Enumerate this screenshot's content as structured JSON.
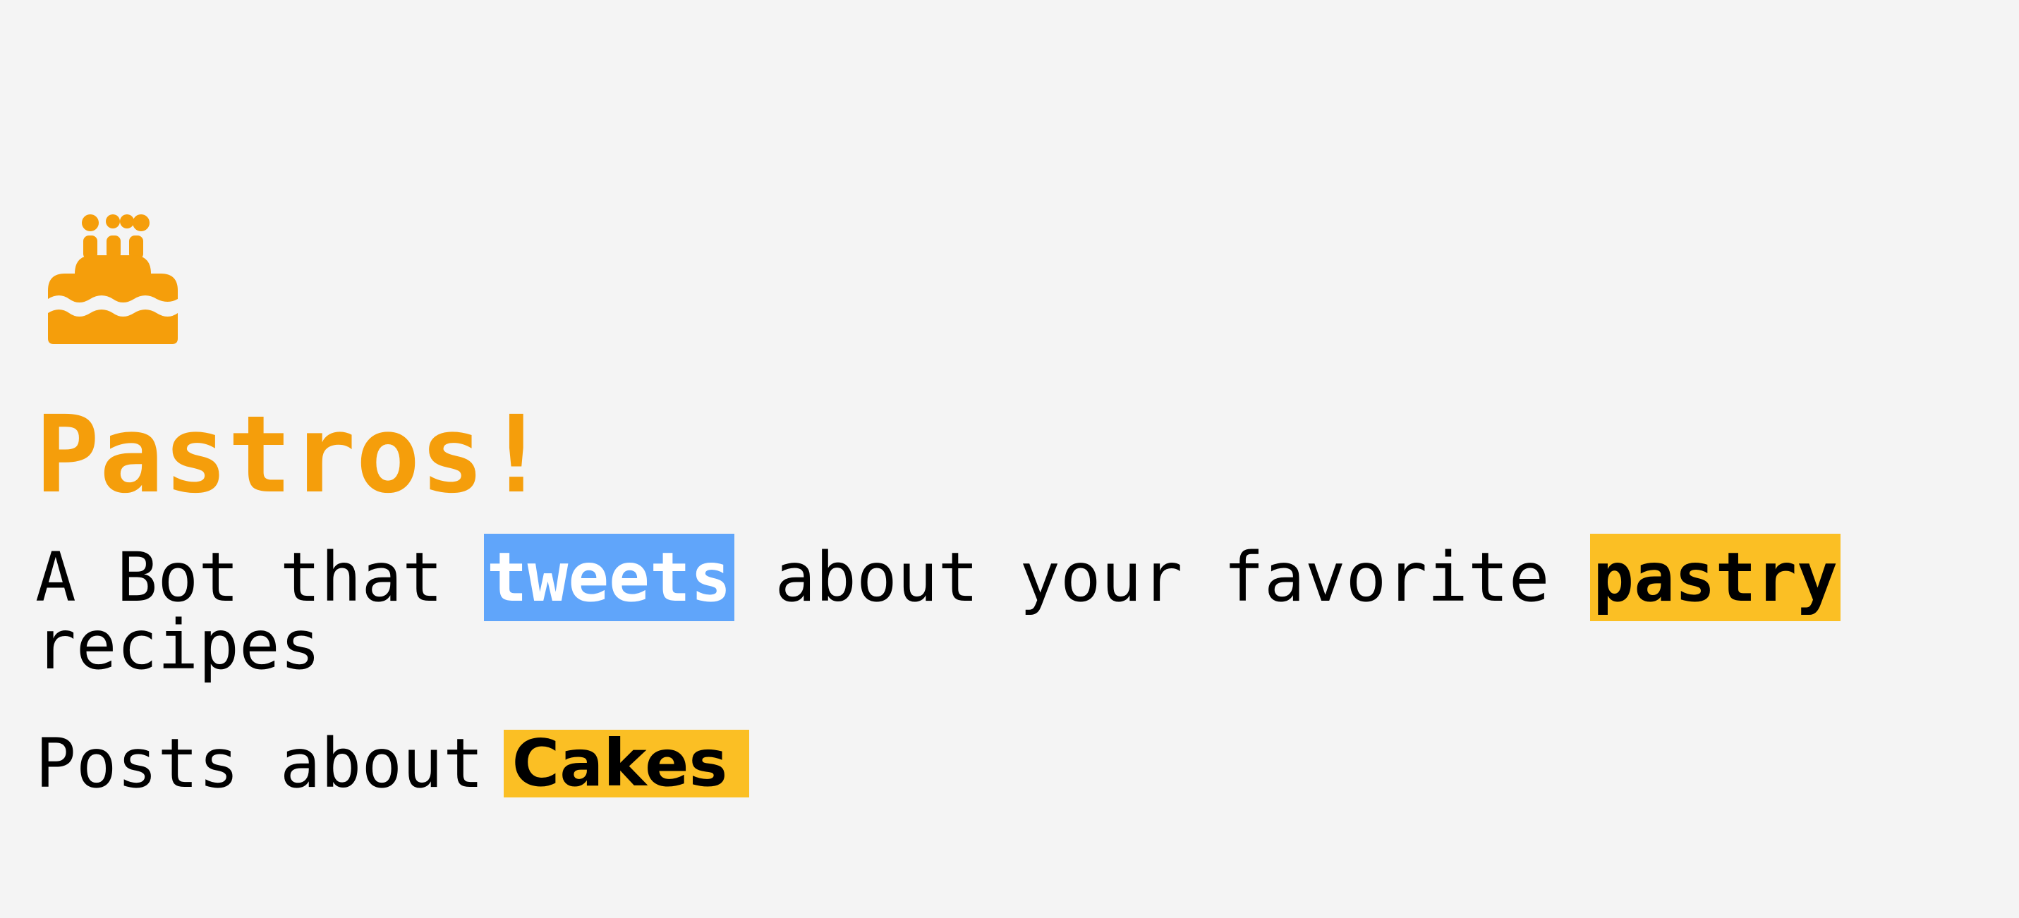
{
  "app": {
    "icon": "cake-icon",
    "title": "Pastros!",
    "accent_color": "#f59e0b"
  },
  "tagline": {
    "part1": "A Bot that ",
    "highlight1": "tweets",
    "part2": " about your favorite ",
    "highlight2": "pastry",
    "part3": " recipes",
    "highlight1_color": "#60a5fa",
    "highlight2_color": "#fbbf24"
  },
  "posts": {
    "label": "Posts about",
    "selected_topic": "Cakes",
    "selector_color": "#fbbf24"
  }
}
